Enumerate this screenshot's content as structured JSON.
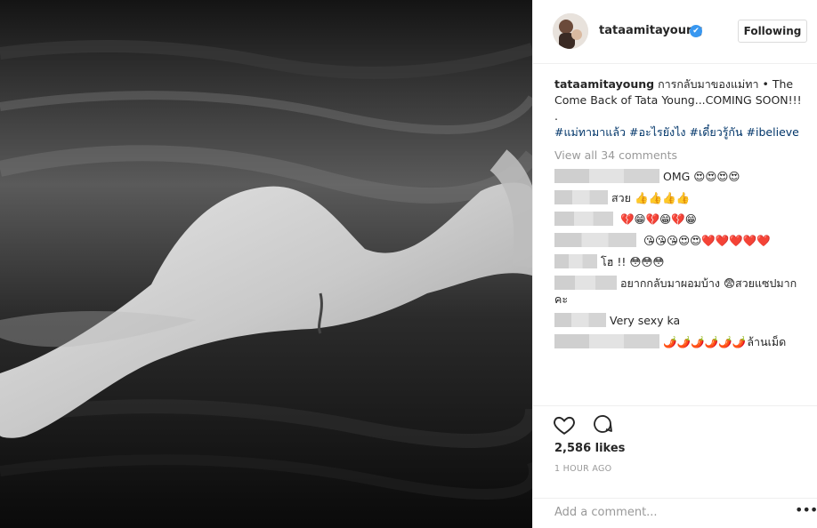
{
  "post": {
    "username": "tataamitayoung",
    "verified_badge": "✔",
    "follow_button": "Following",
    "caption_text": "การกลับมาของแม่ทา • The Come Back of Tata Young...COMING SOON!!!",
    "caption_dot": ".",
    "hashtags": [
      "#แม่ทามาแล้ว",
      "#อะไรยังไง",
      "#เดี๋ยวรู้กัน",
      "#ibelieve"
    ],
    "view_all": "View all 34 comments",
    "likes": "2,586 likes",
    "time": "1 HOUR AGO",
    "add_comment_placeholder": "Add a comment...",
    "more_options": "•••"
  },
  "comments": [
    {
      "text": "OMG",
      "emoji": "😍😍😍😍"
    },
    {
      "text": "สวย",
      "emoji": "👍👍👍👍"
    },
    {
      "text": "",
      "emoji": "💔😁💔😁💔😁"
    },
    {
      "text": "",
      "emoji": "😘😘😘😍😍❤️❤️❤️❤️❤️"
    },
    {
      "text": "โฮ !!",
      "emoji": "😳😳😳"
    },
    {
      "text": "อยากกลับมาผอมบ้าง 😨สวยแซปมากคะ",
      "emoji": ""
    },
    {
      "text": "Very sexy ka",
      "emoji": ""
    },
    {
      "text": "",
      "emoji": "🌶️🌶️🌶️🌶️🌶️🌶️",
      "text_after": "ล้านเม็ด"
    }
  ],
  "icons": {
    "like": "heart-icon",
    "comment": "comment-bubble-icon",
    "more": "more-dots-icon",
    "verified": "verified-badge-icon"
  },
  "colors": {
    "link": "#003569",
    "accent": "#3897f0",
    "muted": "#999999",
    "border": "#efefef"
  }
}
